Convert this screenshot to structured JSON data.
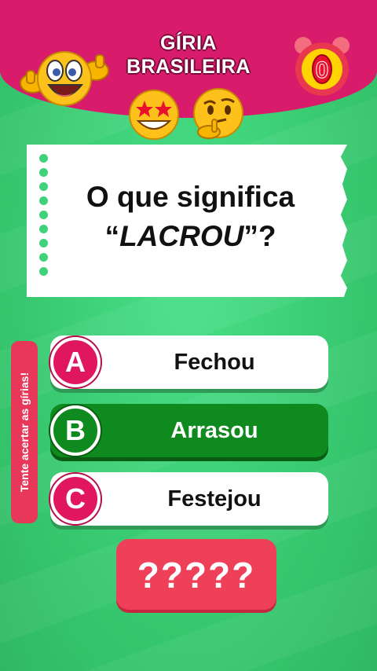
{
  "header": {
    "title_line1": "GÍRIA",
    "title_line2": "BRASILEIRA",
    "timer_value": "0"
  },
  "question": {
    "line1": "O que significa",
    "quote_open": "“",
    "word": "LACROU",
    "quote_close": "”?"
  },
  "side_label": "Tente acertar as gírias!",
  "options": [
    {
      "letter": "A",
      "text": "Fechou",
      "state": "default"
    },
    {
      "letter": "B",
      "text": "Arrasou",
      "state": "correct"
    },
    {
      "letter": "C",
      "text": "Festejou",
      "state": "default"
    }
  ],
  "next_button": "?????",
  "colors": {
    "header": "#d81b6b",
    "background": "#3fd27a",
    "correct": "#0f8a1e",
    "letter_badge": "#e0175f",
    "button": "#ef4059"
  },
  "icons": [
    "thumbs-up-face-emoji",
    "alarm-clock-icon",
    "star-struck-emoji",
    "thinking-face-emoji"
  ]
}
